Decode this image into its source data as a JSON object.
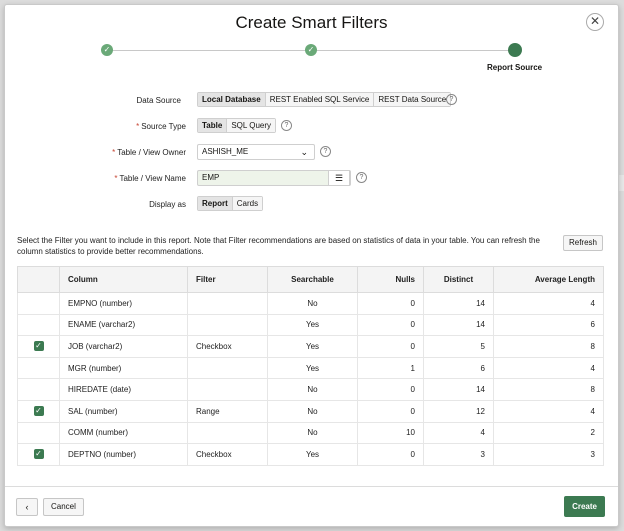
{
  "dialog": {
    "title": "Create Smart Filters",
    "close_symbol": "✕"
  },
  "wizard": {
    "steps": [
      {
        "status": "complete",
        "icon": "check-icon",
        "symbol": "✓"
      },
      {
        "status": "complete",
        "icon": "check-icon",
        "symbol": "✓"
      },
      {
        "status": "current",
        "label": "Report Source"
      }
    ]
  },
  "form": {
    "data_source": {
      "label": "Data Source",
      "options": [
        "Local Database",
        "REST Enabled SQL Service",
        "REST Data Source"
      ],
      "selected": "Local Database"
    },
    "source_type": {
      "label": "Source Type",
      "required": true,
      "options": [
        "Table",
        "SQL Query"
      ],
      "selected": "Table"
    },
    "owner": {
      "label": "Table / View Owner",
      "required": true,
      "value": "ASHISH_ME"
    },
    "table_name": {
      "label": "Table / View Name",
      "required": true,
      "value": "EMP",
      "button_icon": "list-icon"
    },
    "display_as": {
      "label": "Display as",
      "options": [
        "Report",
        "Cards"
      ],
      "selected": "Report"
    },
    "help_symbol": "?",
    "required_marker": "*",
    "chevron": "⌄",
    "list_symbol": "☰"
  },
  "description": "Select the Filter you want to include in this report. Note that Filter recommendations are based on statistics of data in your table. You can refresh the column statistics to provide better recommendations.",
  "refresh_label": "Refresh",
  "table": {
    "headers": [
      "",
      "Column",
      "Filter",
      "Searchable",
      "Nulls",
      "Distinct",
      "Average Length"
    ],
    "rows": [
      {
        "checked": false,
        "column": "EMPNO (number)",
        "filter": "",
        "searchable": "No",
        "nulls": "0",
        "distinct": "14",
        "avg": "4"
      },
      {
        "checked": false,
        "column": "ENAME (varchar2)",
        "filter": "",
        "searchable": "Yes",
        "nulls": "0",
        "distinct": "14",
        "avg": "6"
      },
      {
        "checked": true,
        "column": "JOB (varchar2)",
        "filter": "Checkbox",
        "searchable": "Yes",
        "nulls": "0",
        "distinct": "5",
        "avg": "8"
      },
      {
        "checked": false,
        "column": "MGR (number)",
        "filter": "",
        "searchable": "Yes",
        "nulls": "1",
        "distinct": "6",
        "avg": "4"
      },
      {
        "checked": false,
        "column": "HIREDATE (date)",
        "filter": "",
        "searchable": "No",
        "nulls": "0",
        "distinct": "14",
        "avg": "8"
      },
      {
        "checked": true,
        "column": "SAL (number)",
        "filter": "Range",
        "searchable": "No",
        "nulls": "0",
        "distinct": "12",
        "avg": "4"
      },
      {
        "checked": false,
        "column": "COMM (number)",
        "filter": "",
        "searchable": "No",
        "nulls": "10",
        "distinct": "4",
        "avg": "2"
      },
      {
        "checked": true,
        "column": "DEPTNO (number)",
        "filter": "Checkbox",
        "searchable": "Yes",
        "nulls": "0",
        "distinct": "3",
        "avg": "3"
      }
    ],
    "check_symbol": "✓"
  },
  "footer": {
    "back_symbol": "‹",
    "cancel_label": "Cancel",
    "create_label": "Create"
  },
  "colors": {
    "accent": "#3c7a51",
    "step_complete": "#6aa978",
    "required": "#c74634"
  }
}
